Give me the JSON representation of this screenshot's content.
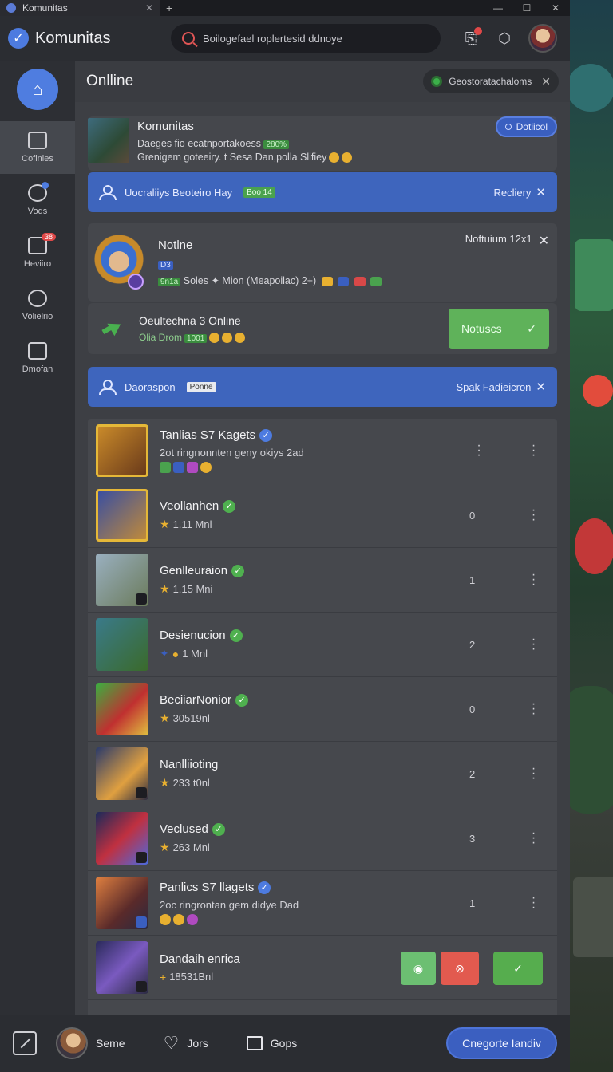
{
  "window": {
    "tab_title": "Komunitas",
    "tab_close": "✕",
    "new_tab": "+",
    "controls": [
      "—",
      "☐",
      "✕"
    ]
  },
  "appbar": {
    "brand": "Komunitas",
    "search_placeholder": "Boilogefael roplertesid ddnoye"
  },
  "sidebar": {
    "items": [
      {
        "label": "Cofinles"
      },
      {
        "label": "Vods",
        "badge": "+"
      },
      {
        "label": "Heviiro",
        "badge": "38"
      },
      {
        "label": "Volielrio"
      },
      {
        "label": "Dmofan"
      }
    ]
  },
  "main": {
    "title": "Onlline",
    "status_chip": "Geostoratachaloms",
    "close": "✕"
  },
  "community": {
    "name": "Komunitas",
    "line1": "Daeges  fio ecatnportakoess",
    "line1_tag": "280%",
    "line2": "Grenigem goteeiry. t Sesa Dan,polla Slifiey",
    "action": "Dotiicol"
  },
  "banner1": {
    "text": "Uocraliiys Beoteiro Hay",
    "tag": "Boo 14",
    "right": "Recliery",
    "close": "✕"
  },
  "profile": {
    "name": "Notlne",
    "sub": "D3",
    "tag": "9n1a",
    "line": "Soles ✦ Mion (Meapoilac) 2+)",
    "right": "Noftuium 12x1",
    "close": "✕"
  },
  "online": {
    "title": "Oeultechna 3 Online",
    "sub": "Olia Drom",
    "tag": "1001",
    "button": "Notuscs",
    "button_icon": "✓"
  },
  "banner2": {
    "text": "Daoraspon",
    "tag": "Ponne",
    "right": "Spak Fadieicron",
    "close": "✕"
  },
  "list": [
    {
      "name": "Tanlias S7 Kagets",
      "meta": "2ot ringnonnten geny okiys 2ad",
      "count": "",
      "verified": "blue"
    },
    {
      "name": "Veollanhen",
      "meta": "1.11 Mnl",
      "count": "0",
      "verified": "green"
    },
    {
      "name": "Genlleuraion",
      "meta": "1.15 Mni",
      "count": "1",
      "verified": "green"
    },
    {
      "name": "Desienucion",
      "meta": "1 Mnl",
      "count": "2",
      "verified": "green"
    },
    {
      "name": "BeciiarNonior",
      "meta": "30519nl",
      "count": "0",
      "verified": "green"
    },
    {
      "name": "Nanlliioting",
      "meta": "233 t0nl",
      "count": "2",
      "verified": ""
    },
    {
      "name": "Veclused",
      "meta": "263 Mnl",
      "count": "3",
      "verified": "green"
    },
    {
      "name": "Panlics S7 llagets",
      "meta": "2oc ringrontan gem didye Dad",
      "count": "1",
      "verified": "blue"
    },
    {
      "name": "Dandaih enrica",
      "meta": "18531Bnl",
      "count": "",
      "verified": ""
    }
  ],
  "bottombar": {
    "profile": "Seme",
    "likes": "Jors",
    "chat": "Gops",
    "cta": "Cnegorte Iandiv"
  }
}
